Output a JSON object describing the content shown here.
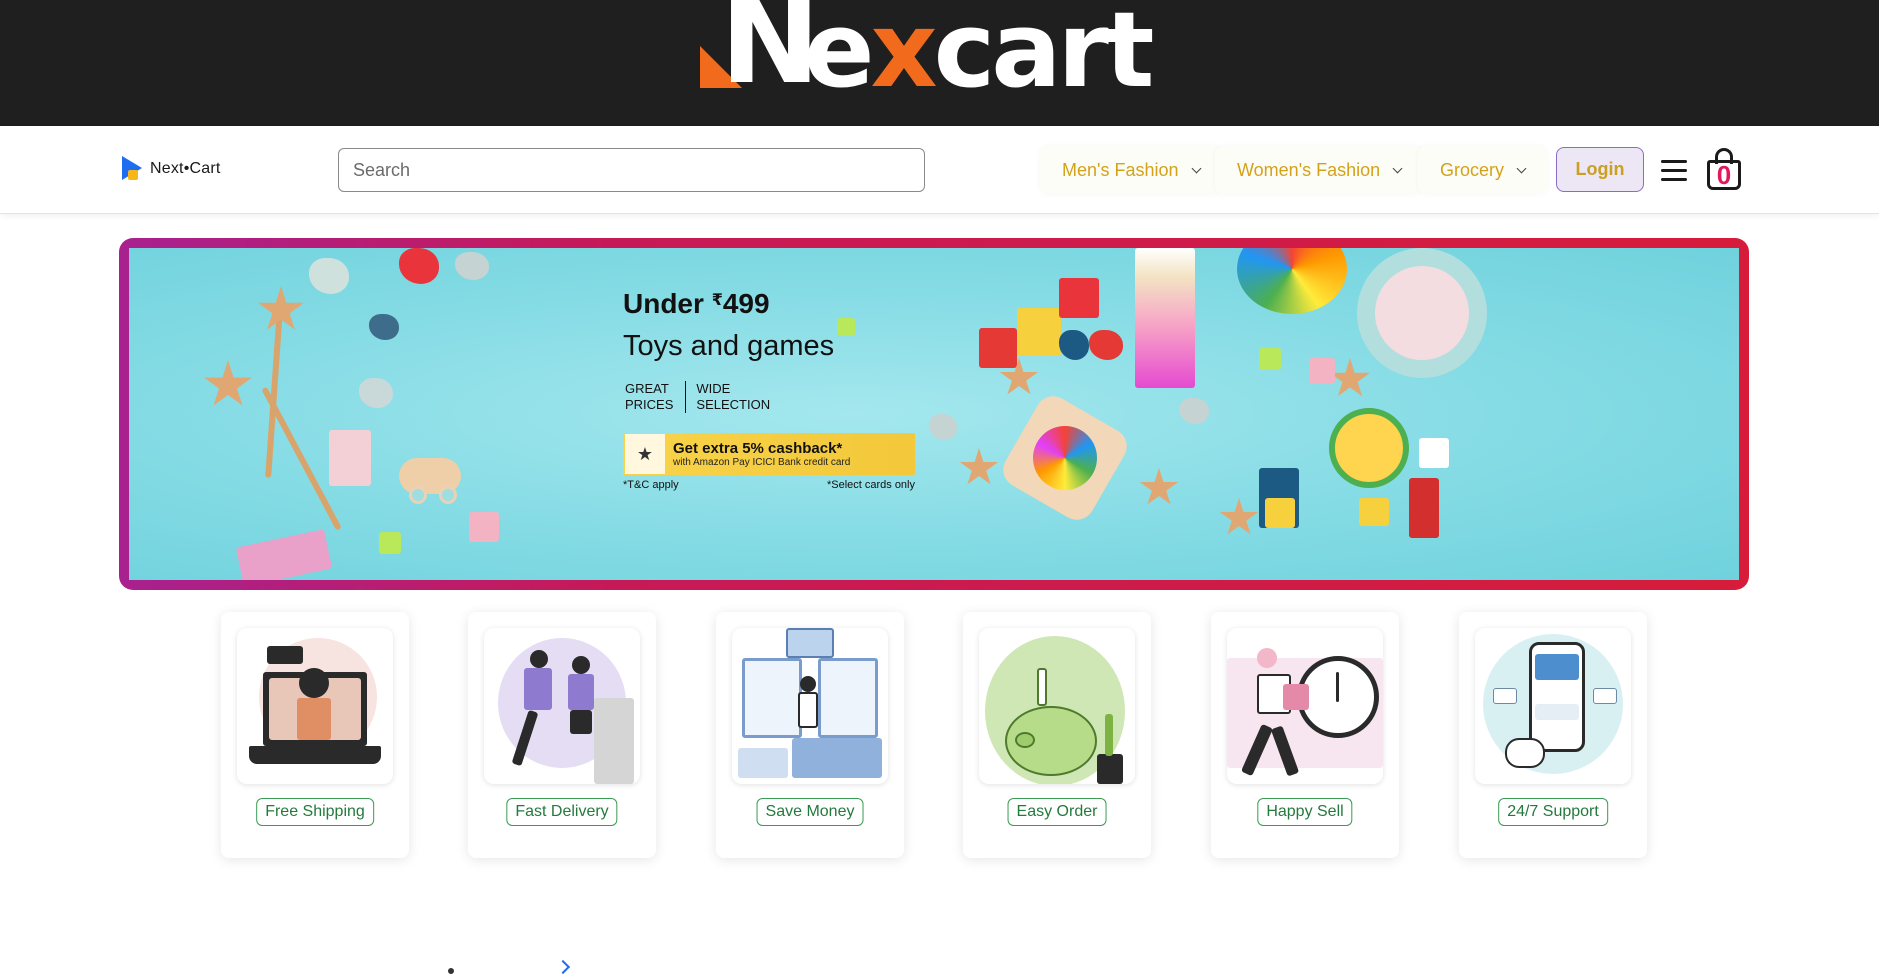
{
  "brand": {
    "big_logo_prefix": "N",
    "big_logo_word_start": "e",
    "big_logo_word_accent": "x",
    "big_logo_word_end": "cart",
    "small_logo": "Next•Cart",
    "accent_color": "#f26a1b"
  },
  "navbar": {
    "search_placeholder": "Search",
    "menus": [
      {
        "label": "Men's Fashion"
      },
      {
        "label": "Women's Fashion"
      },
      {
        "label": "Grocery"
      }
    ],
    "login_label": "Login",
    "cart_count": "0",
    "icons": [
      "hamburger-menu-icon",
      "shopping-bag-icon",
      "chevron-down-icon"
    ]
  },
  "hero": {
    "price_prefix": "Under ",
    "currency": "₹",
    "price": "499",
    "category": "Toys and games",
    "feature_1_line1": "GREAT",
    "feature_1_line2": "PRICES",
    "feature_2_line1": "WIDE",
    "feature_2_line2": "SELECTION",
    "offer_title": "Get extra 5% cashback*",
    "offer_subtitle": "with Amazon Pay ICICI Bank credit card",
    "note_left": "*T&C apply",
    "note_right": "*Select cards only",
    "border_colors": [
      "#a8218f",
      "#d61c3a"
    ],
    "background_color": "#86dde6"
  },
  "features": [
    {
      "label": "Free Shipping"
    },
    {
      "label": "Fast Delivery"
    },
    {
      "label": "Save Money"
    },
    {
      "label": "Easy Order"
    },
    {
      "label": "Happy Sell"
    },
    {
      "label": "24/7 Support"
    }
  ],
  "colors": {
    "menu_text": "#d4a21a",
    "feature_tag": "#237a3c",
    "cart_count": "#e2185b",
    "top_banner": "#1f1f1f"
  }
}
